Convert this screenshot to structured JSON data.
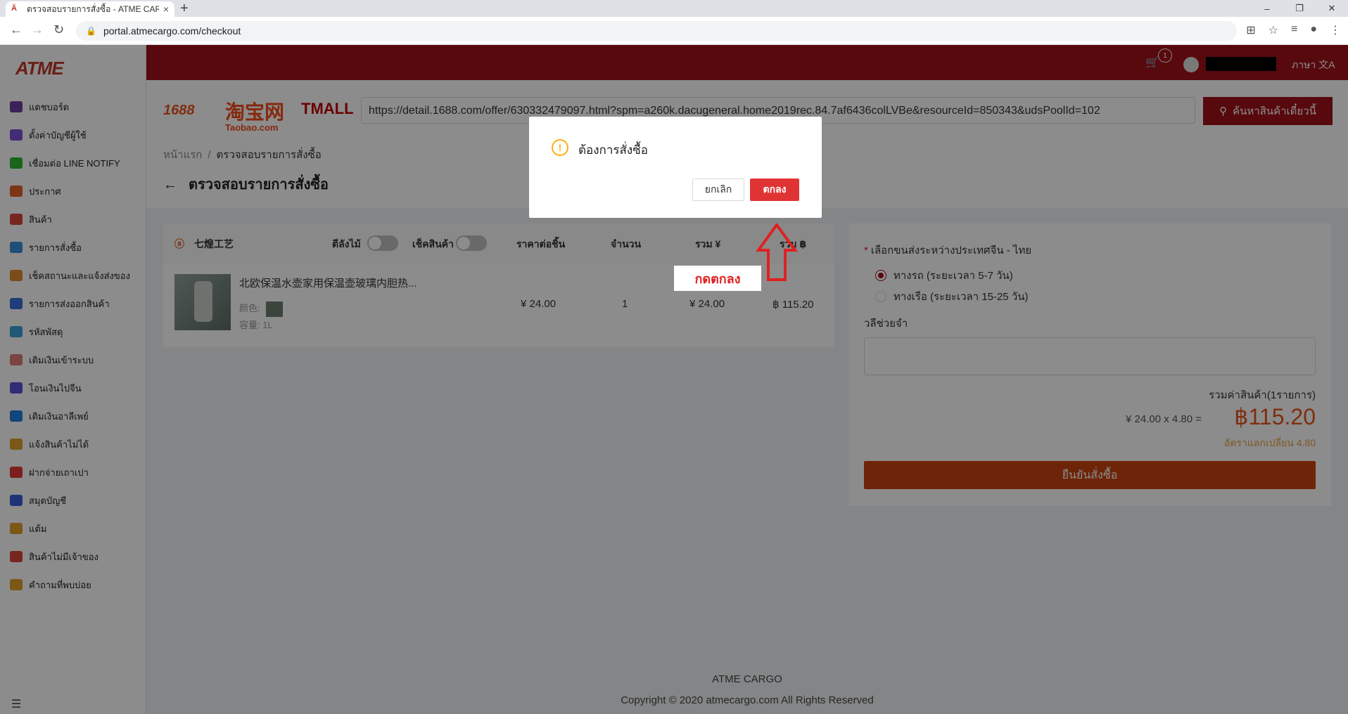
{
  "browser": {
    "tab_title": "ตรวจสอบรายการสั่งซื้อ - ATME CARGO",
    "tab_close": "×",
    "new_tab": "+",
    "url": "portal.atmecargo.com/checkout",
    "window_controls": [
      "–",
      "❐",
      "✕"
    ]
  },
  "sidebar": {
    "logo": "ATME",
    "items": [
      {
        "label": "แดชบอร์ด",
        "icon": "dashboard-icon",
        "color": "#6b3fa0"
      },
      {
        "label": "ตั้งค่าบัญชีผู้ใช้",
        "icon": "user-settings-icon",
        "color": "#7d4fd6"
      },
      {
        "label": "เชื่อมต่อ LINE NOTIFY",
        "icon": "line-icon",
        "color": "#2eb82e"
      },
      {
        "label": "ประกาศ",
        "icon": "megaphone-icon",
        "color": "#e0612b"
      },
      {
        "label": "สินค้า",
        "icon": "product-icon",
        "color": "#d9453a"
      },
      {
        "label": "รายการสั่งซื้อ",
        "icon": "order-icon",
        "color": "#3a8fd9"
      },
      {
        "label": "เช็คสถานะและแจ้งส่งของ",
        "icon": "truck-icon",
        "color": "#e08a2b"
      },
      {
        "label": "รายการส่งออกสินค้า",
        "icon": "export-icon",
        "color": "#3a6fd9"
      },
      {
        "label": "รหัสพัสดุ",
        "icon": "box-icon",
        "color": "#3aa3d9"
      },
      {
        "label": "เติมเงินเข้าระบบ",
        "icon": "piggy-bank-icon",
        "color": "#e07a7a"
      },
      {
        "label": "โอนเงินไปจีน",
        "icon": "yuan-icon",
        "color": "#5b4fd6"
      },
      {
        "label": "เติมเงินอาลีเพย์",
        "icon": "alipay-icon",
        "color": "#1f7fe0"
      },
      {
        "label": "แจ้งสินค้าไม่ได้",
        "icon": "no-product-icon",
        "color": "#e0a02b"
      },
      {
        "label": "ฝากจ่ายเถาเปา",
        "icon": "taobao-pay-icon",
        "color": "#e03a3a"
      },
      {
        "label": "สมุดบัญชี",
        "icon": "book-icon",
        "color": "#3a5fd9"
      },
      {
        "label": "แต้ม",
        "icon": "points-icon",
        "color": "#e0a02b"
      },
      {
        "label": "สินค้าไม่มีเจ้าของ",
        "icon": "unowned-product-icon",
        "color": "#d9453a"
      },
      {
        "label": "คำถามที่พบบ่อย",
        "icon": "faq-icon",
        "color": "#e0a02b"
      }
    ]
  },
  "header": {
    "cart_count": "1",
    "language_label": "ภาษา"
  },
  "search": {
    "brands": [
      "1688",
      "淘宝网",
      "Taobao.com",
      "TMALL"
    ],
    "url_value": "https://detail.1688.com/offer/630332479097.html?spm=a260k.dacugeneral.home2019rec.84.7af6436colLVBe&resourceId=850343&udsPoolId=102",
    "button_label": "ค้นหาสินค้าเดี๋ยวนี้"
  },
  "breadcrumb": {
    "home": "หน้าแรก",
    "sep": "/",
    "current": "ตรวจสอบรายการสั่งซื้อ"
  },
  "page_title": "ตรวจสอบรายการสั่งซื้อ",
  "cart": {
    "shop_name": "七煌工艺",
    "headers": {
      "crate": "ตีลังไม้",
      "check": "เช็คสินค้า",
      "unit_price": "ราคาต่อชิ้น",
      "qty": "จำนวน",
      "total_yuan": "รวม ¥",
      "total_baht": "รวม ฿"
    },
    "item": {
      "name": "北欧保温水壶家用保温壶玻璃内胆热...",
      "color_label": "颜色:",
      "capacity": "容量: 1L",
      "unit_price": "¥ 24.00",
      "qty": "1",
      "total_yuan": "¥ 24.00",
      "total_baht": "฿ 115.20"
    }
  },
  "callout": "กดตกลง",
  "summary": {
    "shipping_label": "เลือกขนส่งระหว่างประเทศจีน - ไทย",
    "required_mark": "*",
    "options": [
      {
        "label": "ทางรถ (ระยะเวลา 5-7 วัน)",
        "selected": true
      },
      {
        "label": "ทางเรือ (ระยะเวลา 15-25 วัน)",
        "selected": false
      }
    ],
    "note_label": "วลีช่วยจำ",
    "total_label": "รวมค่าสินค้า(1รายการ)",
    "calc": "¥ 24.00 x 4.80 =",
    "total": "฿115.20",
    "rate": "อัตราแลกเปลี่ยน 4.80",
    "confirm_button": "ยืนยันสั่งซื้อ"
  },
  "footer": {
    "brand": "ATME CARGO",
    "copyright": "Copyright © 2020 atmecargo.com All Rights Reserved"
  },
  "modal": {
    "title": "ต้องการสั่งซื้อ",
    "cancel": "ยกเลิก",
    "ok": "ตกลง"
  }
}
